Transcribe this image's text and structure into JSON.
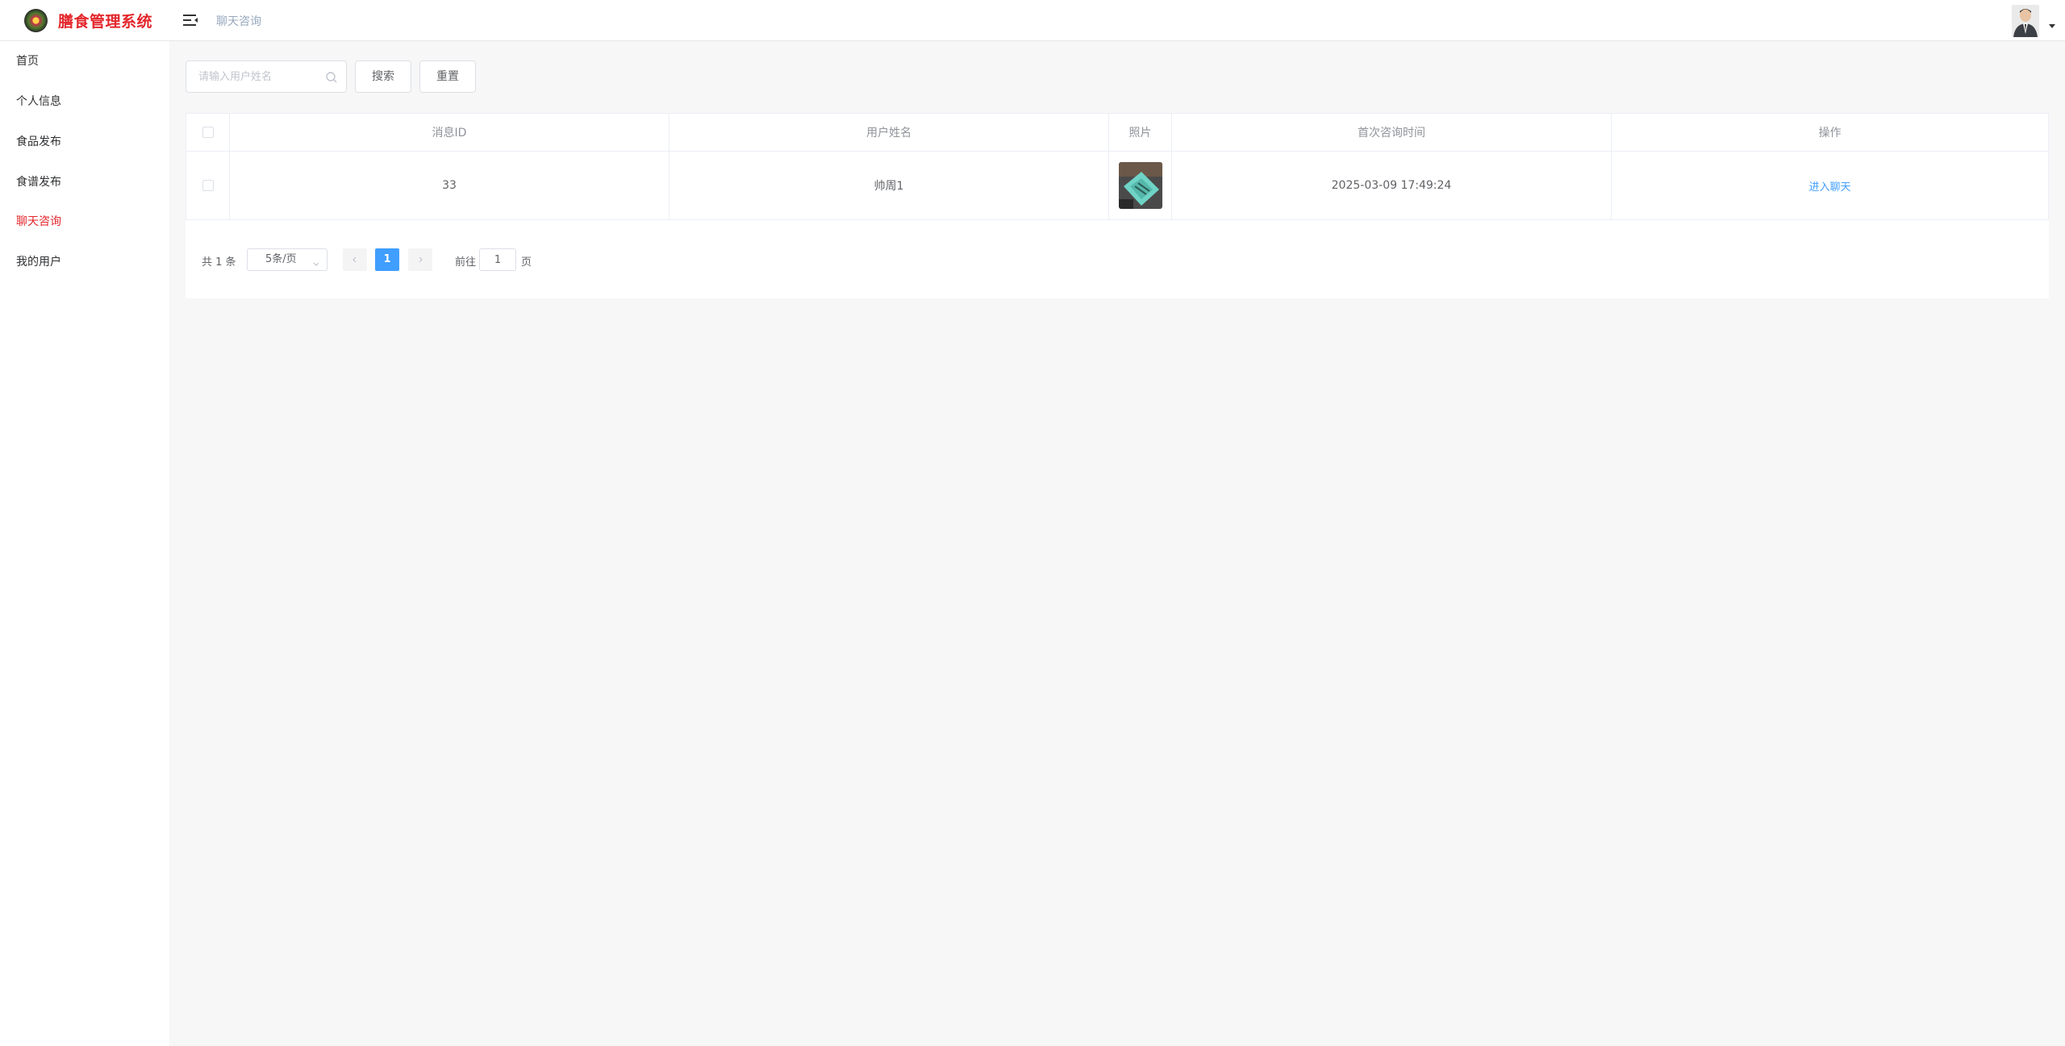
{
  "header": {
    "title": "膳食管理系统",
    "breadcrumb": "聊天咨询"
  },
  "sidebar": {
    "items": [
      {
        "label": "首页"
      },
      {
        "label": "个人信息"
      },
      {
        "label": "食品发布"
      },
      {
        "label": "食谱发布"
      },
      {
        "label": "聊天咨询",
        "active": true
      },
      {
        "label": "我的用户"
      }
    ]
  },
  "toolbar": {
    "search_placeholder": "请输入用户姓名",
    "search_label": "搜索",
    "reset_label": "重置"
  },
  "table": {
    "columns": [
      "消息ID",
      "用户姓名",
      "照片",
      "首次咨询时间",
      "操作"
    ],
    "rows": [
      {
        "id": "33",
        "name": "帅周1",
        "time": "2025-03-09 17:49:24",
        "action": "进入聊天"
      }
    ]
  },
  "pagination": {
    "total": "共 1 条",
    "page_size": "5条/页",
    "current_page": "1",
    "goto_label": "前往",
    "goto_value": "1",
    "goto_suffix": "页"
  },
  "colors": {
    "brand": "#e3262b",
    "primary": "#409eff"
  }
}
